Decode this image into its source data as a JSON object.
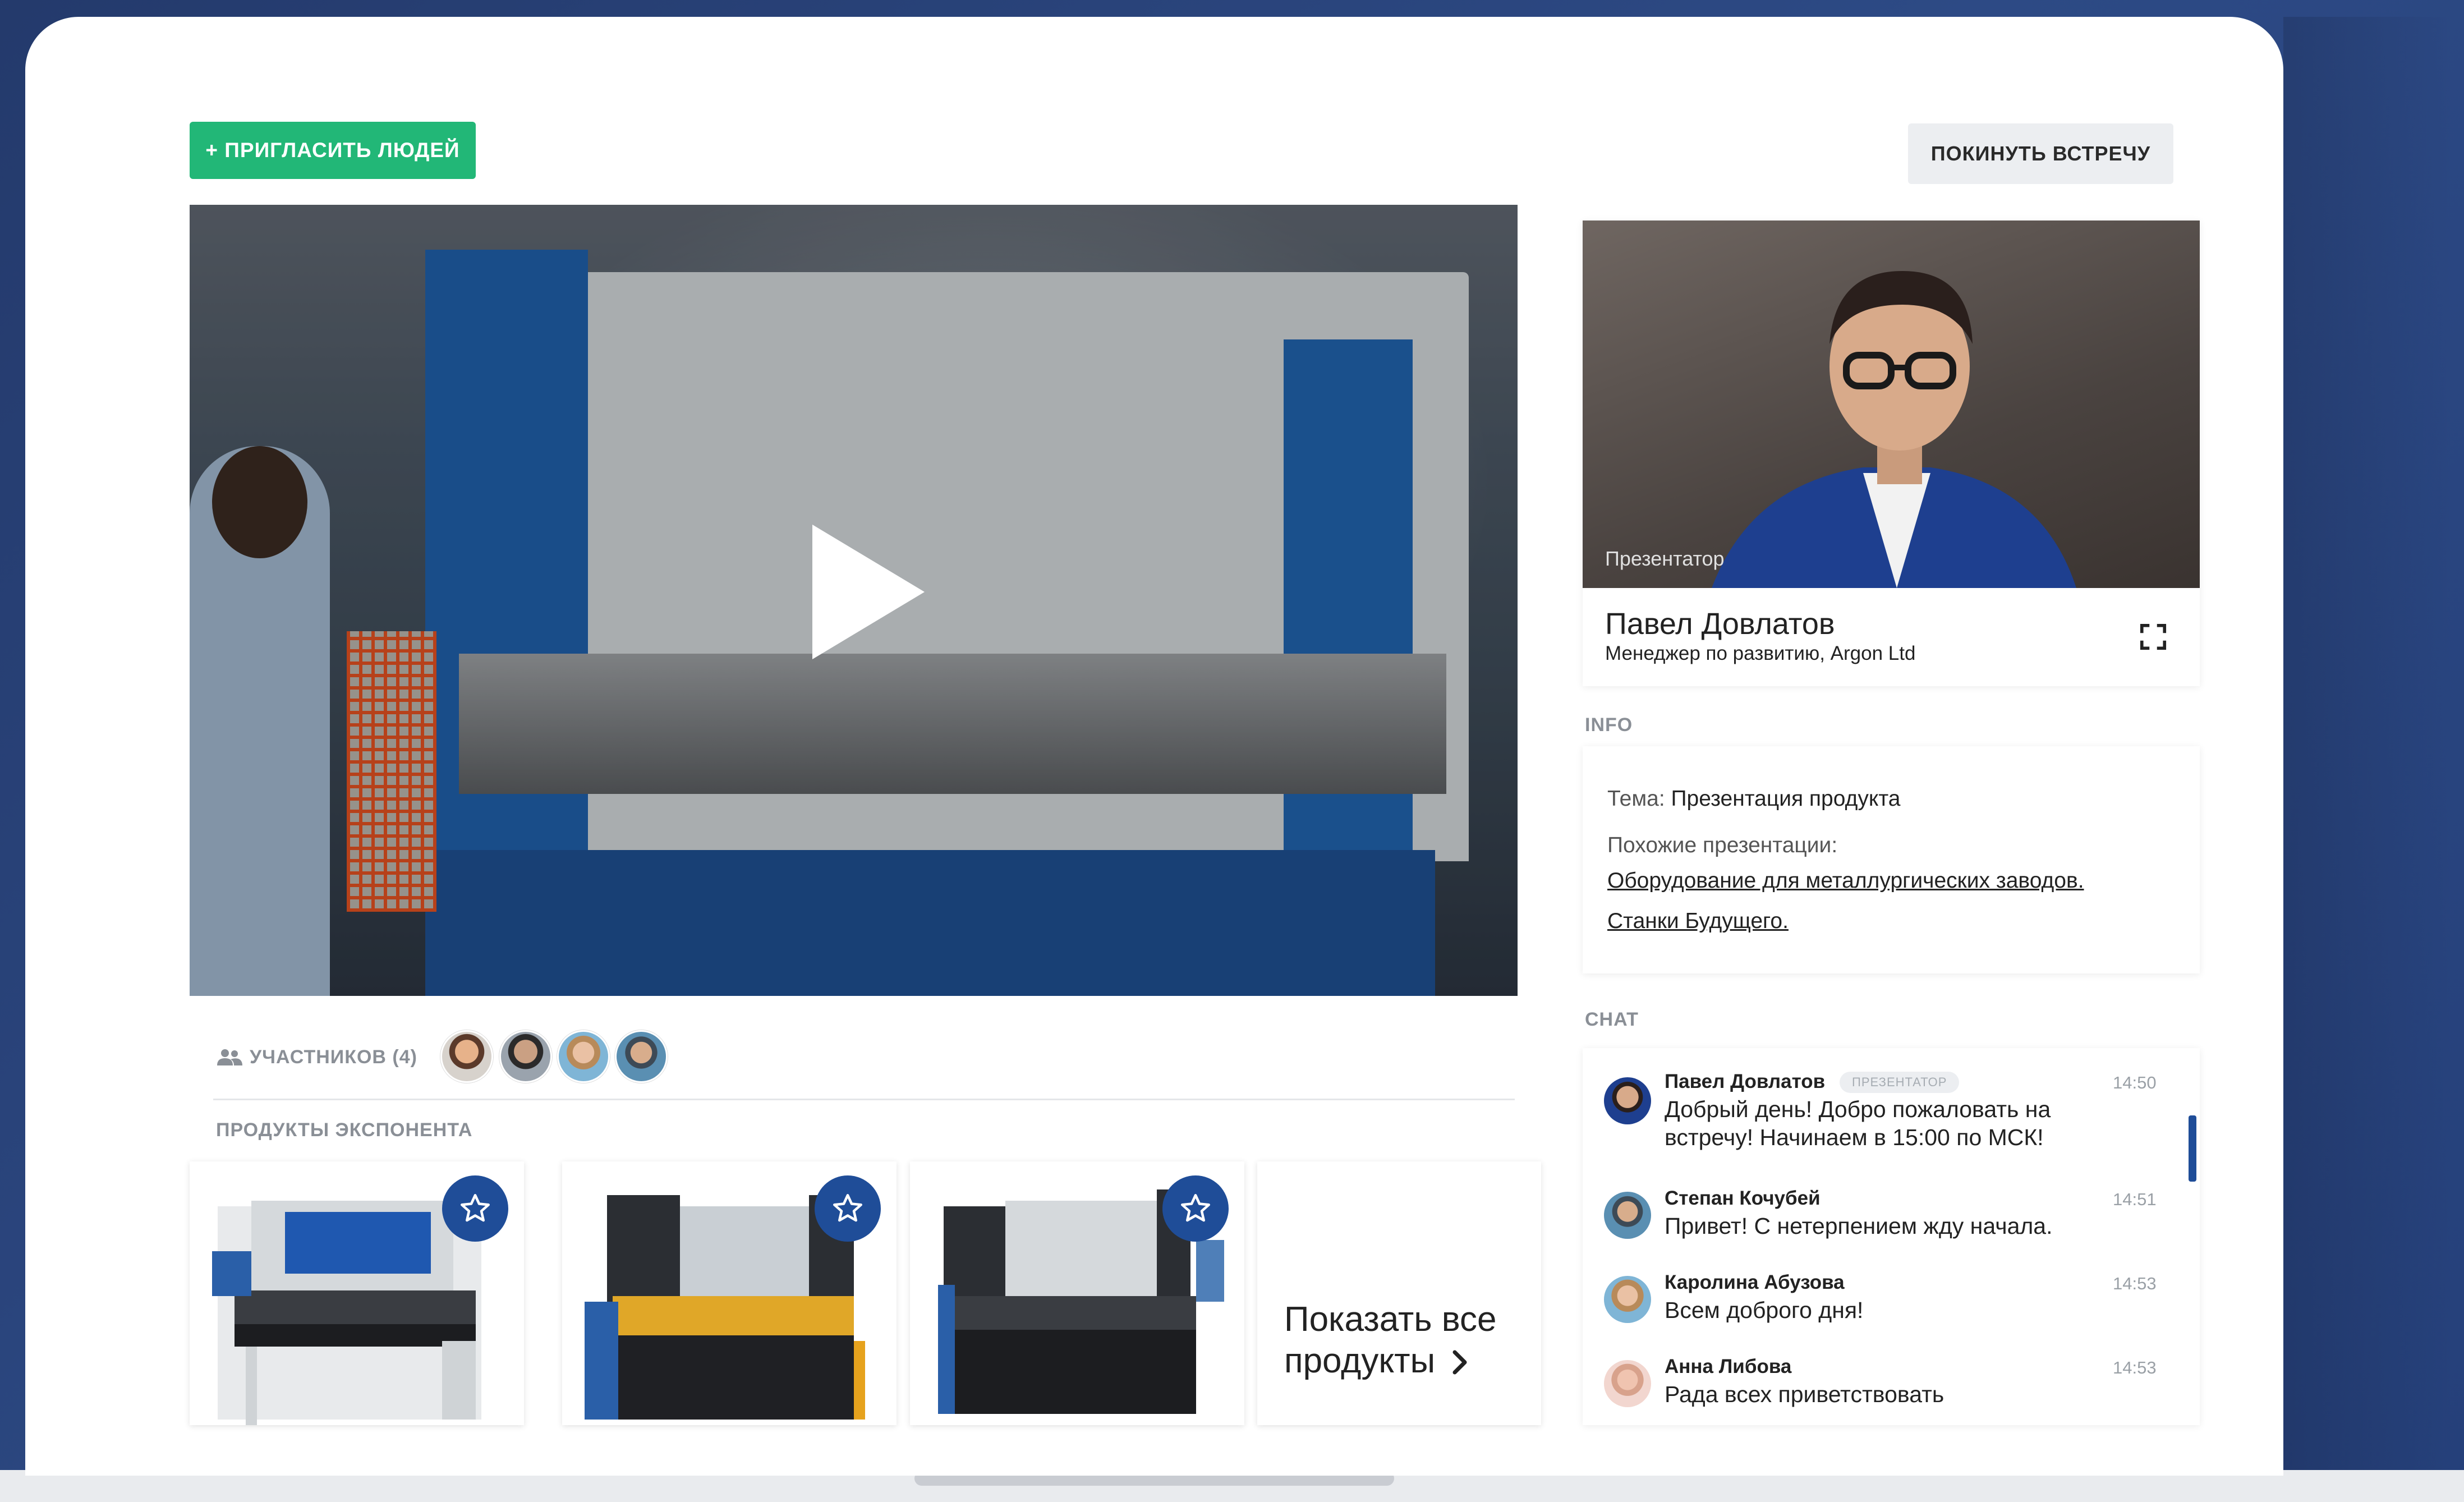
{
  "header": {
    "invite_label": "+ ПРИГЛАСИТЬ ЛЮДЕЙ",
    "leave_label": "ПОКИНУТЬ ВСТРЕЧУ"
  },
  "video": {
    "play_icon": "play-icon"
  },
  "participants": {
    "label": "УЧАСТНИКОВ (4)",
    "icon": "people-icon",
    "avatars": [
      "avatar-1",
      "avatar-2",
      "avatar-3",
      "avatar-4"
    ]
  },
  "products": {
    "label": "ПРОДУКТЫ ЭКСПОНЕНТА",
    "items": [
      {
        "name": "product-1",
        "favorite_icon": "star-icon"
      },
      {
        "name": "product-2",
        "favorite_icon": "star-icon"
      },
      {
        "name": "product-3",
        "favorite_icon": "star-icon"
      }
    ],
    "show_all_label": "Показать все продукты",
    "show_all_icon": "chevron-right-icon"
  },
  "presenter": {
    "caption": "Презентатор",
    "name": "Павел Довлатов",
    "role": "Менеджер по развитию, Argon Ltd",
    "expand_icon": "fullscreen-icon"
  },
  "info": {
    "label": "INFO",
    "topic_label": "Тема:",
    "topic_value": "Презентация продукта",
    "similar_label": "Похожие презентации:",
    "links": [
      "Оборудование для металлургических заводов.",
      "Станки Будущего."
    ]
  },
  "chat": {
    "label": "CHAT",
    "messages": [
      {
        "author": "Павел Довлатов",
        "badge": "ПРЕЗЕНТАТОР",
        "text": "Добрый день! Добро пожаловать на встречу! Начинаем в 15:00 по МСК!",
        "time": "14:50"
      },
      {
        "author": "Степан Кочубей",
        "text": "Привет! С нетерпением жду начала.",
        "time": "14:51"
      },
      {
        "author": "Каролина Абузова",
        "text": "Всем доброго дня!",
        "time": "14:53"
      },
      {
        "author": "Анна Либова",
        "text": "Рада всех приветствовать",
        "time": "14:53"
      }
    ]
  },
  "colors": {
    "accent_green": "#22b777",
    "accent_blue": "#1f4d98",
    "background": "#2d4a85"
  }
}
